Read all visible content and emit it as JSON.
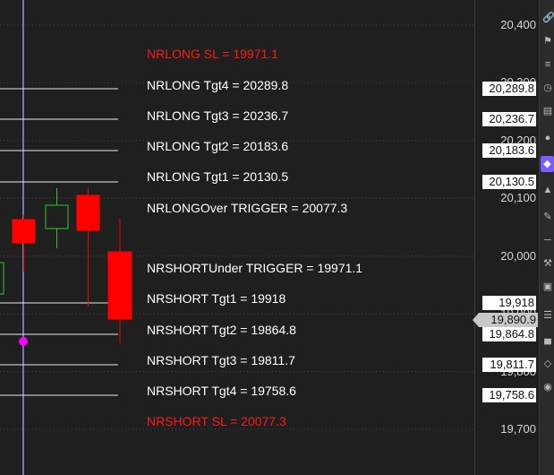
{
  "price_axis": {
    "ticks": [
      "20,400",
      "20,300",
      "20,200",
      "20,100",
      "20,000",
      "19,900",
      "19,800",
      "19,700"
    ]
  },
  "levels": [
    {
      "label": "NRLONG SL = 19971.1",
      "color": "#ff1a1a",
      "tag": ""
    },
    {
      "label": "NRLONG Tgt4 = 20289.8",
      "color": "#ffffff",
      "tag": "20,289.8"
    },
    {
      "label": "NRLONG Tgt3 = 20236.7",
      "color": "#ffffff",
      "tag": "20,236.7"
    },
    {
      "label": "NRLONG Tgt2 = 20183.6",
      "color": "#ffffff",
      "tag": "20,183.6"
    },
    {
      "label": "NRLONG Tgt1 = 20130.5",
      "color": "#ffffff",
      "tag": "20,130.5"
    },
    {
      "label": "NRLONGOver TRIGGER = 20077.3",
      "color": "#ffffff",
      "tag": ""
    },
    {
      "label": "NRSHORTUnder TRIGGER = 19971.1",
      "color": "#ffffff",
      "tag": ""
    },
    {
      "label": "NRSHORT Tgt1 = 19918",
      "color": "#ffffff",
      "tag": "19,918"
    },
    {
      "label": "NRSHORT Tgt2 = 19864.8",
      "color": "#ffffff",
      "tag": "19,864.8"
    },
    {
      "label": "NRSHORT Tgt3 = 19811.7",
      "color": "#ffffff",
      "tag": "19,811.7"
    },
    {
      "label": "NRSHORT Tgt4 = 19758.6",
      "color": "#ffffff",
      "tag": "19,758.6"
    },
    {
      "label": "NRSHORT SL = 20077.3",
      "color": "#ff1a1a",
      "tag": ""
    }
  ],
  "current_price": "19,890.9",
  "colors": {
    "up_candle": "#2fc52f",
    "down_candle": "#ff0000",
    "crosshair": "#9a9aff",
    "marker": "#ff00ff",
    "active_tool": "#7c5cff"
  },
  "toolbar_icons": [
    "link-icon",
    "bookmark-icon",
    "bar-icon",
    "clock-icon",
    "folder-icon",
    "circle-icon",
    "active-tool-icon",
    "pin-icon",
    "brush-icon",
    "ruler-icon",
    "wrench-icon",
    "box-icon",
    "menu-icon",
    "chart-icon",
    "tag-icon",
    "eye-icon"
  ]
}
